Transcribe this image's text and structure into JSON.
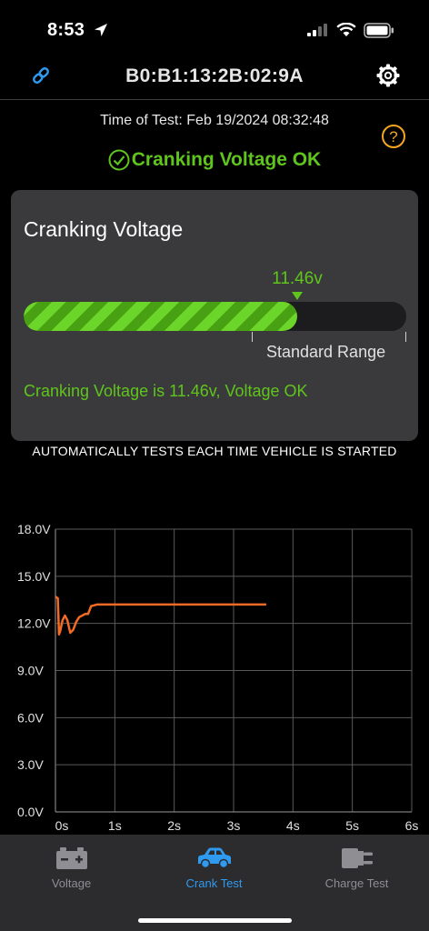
{
  "status_bar": {
    "time": "8:53"
  },
  "header": {
    "device_id": "B0:B1:13:2B:02:9A"
  },
  "test_info": {
    "time_label": "Time of Test:",
    "time_value": "Feb 19/2024 08:32:48"
  },
  "result": {
    "text": "Cranking Voltage OK",
    "color": "#5fc51c"
  },
  "card": {
    "title": "Cranking Voltage",
    "value_label": "11.46v",
    "fill_fraction": 0.714,
    "range_label": "Standard Range",
    "message": "Cranking Voltage is 11.46v, Voltage OK"
  },
  "note": "AUTOMATICALLY TESTS EACH TIME VEHICLE IS STARTED",
  "chart_data": {
    "type": "line",
    "title": "",
    "xlabel": "",
    "ylabel": "",
    "xlim": [
      0,
      6
    ],
    "ylim": [
      0,
      18
    ],
    "grid": true,
    "x_ticks": [
      "0s",
      "1s",
      "2s",
      "3s",
      "4s",
      "5s",
      "6s"
    ],
    "y_ticks": [
      "18.0V",
      "15.0V",
      "12.0V",
      "9.0V",
      "6.0V",
      "3.0V",
      "0.0V"
    ],
    "series": [
      {
        "color": "#f26b24",
        "x": [
          0,
          0.04,
          0.06,
          0.08,
          0.12,
          0.16,
          0.2,
          0.25,
          0.3,
          0.35,
          0.4,
          0.5,
          0.55,
          0.6,
          0.7,
          1.0,
          1.5,
          2.0,
          2.5,
          3.0,
          3.55
        ],
        "y": [
          13.7,
          13.6,
          11.3,
          11.5,
          12.2,
          12.5,
          12.2,
          11.4,
          11.6,
          12.1,
          12.4,
          12.6,
          12.6,
          13.1,
          13.2,
          13.2,
          13.2,
          13.2,
          13.2,
          13.2,
          13.2
        ]
      }
    ]
  },
  "tabs": [
    {
      "label": "Voltage",
      "active": false
    },
    {
      "label": "Crank Test",
      "active": true
    },
    {
      "label": "Charge Test",
      "active": false
    }
  ],
  "colors": {
    "accent_green": "#5fc51c",
    "tab_active": "#2f9bf0",
    "tab_inactive": "#8e8e93",
    "help": "#f5a623"
  }
}
